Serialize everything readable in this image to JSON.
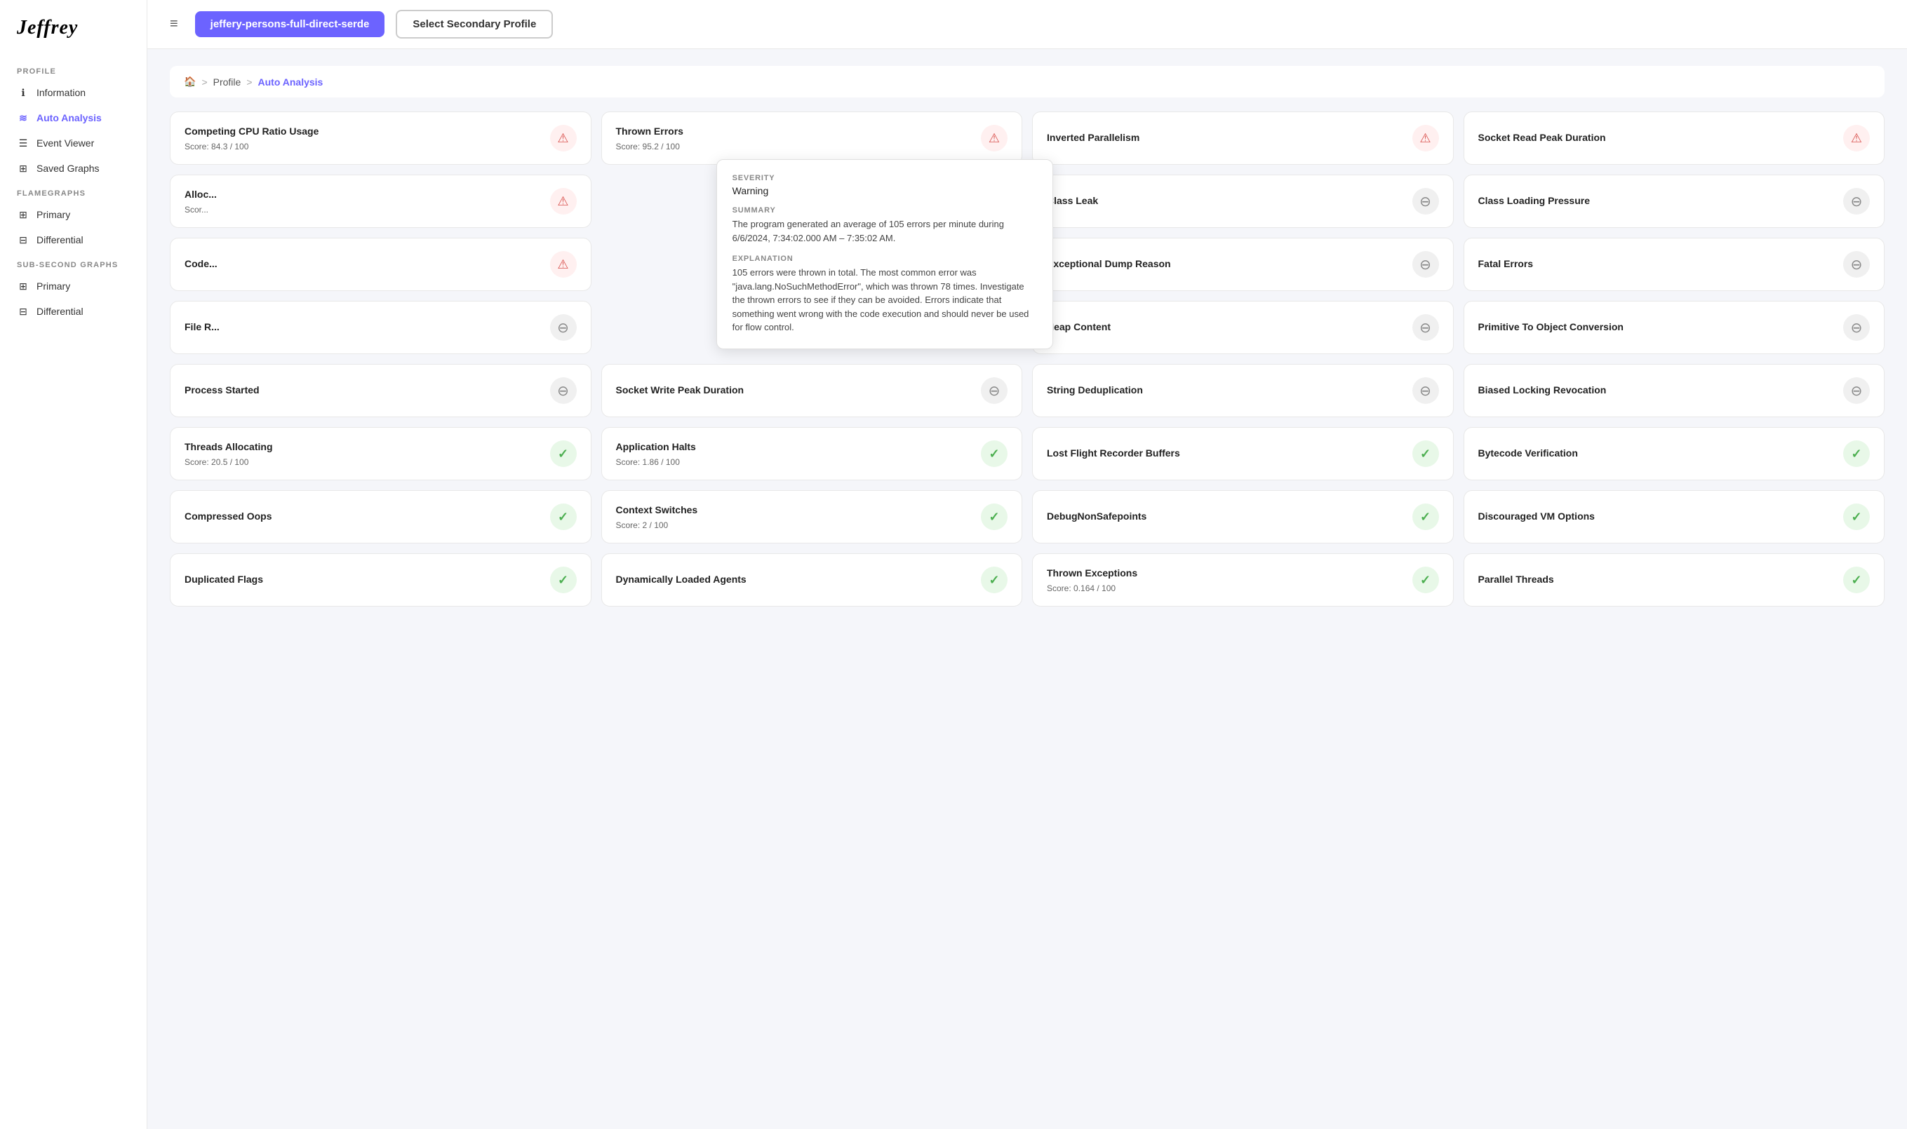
{
  "app": {
    "logo": "Jeffrey",
    "menu_icon": "≡"
  },
  "topbar": {
    "primary_profile_label": "jeffery-persons-full-direct-serde",
    "secondary_profile_label": "Select Secondary Profile"
  },
  "sidebar": {
    "sections": [
      {
        "label": "PROFILE",
        "items": [
          {
            "id": "information",
            "label": "Information",
            "icon": "ℹ",
            "active": false
          },
          {
            "id": "auto-analysis",
            "label": "Auto Analysis",
            "icon": "≋",
            "active": true
          },
          {
            "id": "event-viewer",
            "label": "Event Viewer",
            "icon": "☰",
            "active": false
          },
          {
            "id": "saved-graphs",
            "label": "Saved Graphs",
            "icon": "⊞",
            "active": false
          }
        ]
      },
      {
        "label": "FLAMEGRAPHS",
        "items": [
          {
            "id": "fg-primary",
            "label": "Primary",
            "icon": "⊞",
            "active": false
          },
          {
            "id": "fg-differential",
            "label": "Differential",
            "icon": "⊟",
            "active": false
          }
        ]
      },
      {
        "label": "SUB-SECOND GRAPHS",
        "items": [
          {
            "id": "ssg-primary",
            "label": "Primary",
            "icon": "⊞",
            "active": false
          },
          {
            "id": "ssg-differential",
            "label": "Differential",
            "icon": "⊟",
            "active": false
          }
        ]
      }
    ]
  },
  "breadcrumb": {
    "home": "🏠",
    "sep1": ">",
    "profile": "Profile",
    "sep2": ">",
    "current": "Auto Analysis"
  },
  "tooltip": {
    "severity_label": "Severity",
    "severity_value": "Warning",
    "summary_label": "Summary",
    "summary_text": "The program generated an average of 105 errors per minute during 6/6/2024, 7:34:02.000 AM – 7:35:02 AM.",
    "explanation_label": "Explanation",
    "explanation_text": "105 errors were thrown in total. The most common error was \"java.lang.NoSuchMethodError\", which was thrown 78 times. Investigate the thrown errors to see if they can be avoided. Errors indicate that something went wrong with the code execution and should never be used for flow control."
  },
  "cards": [
    {
      "id": "competing-cpu",
      "title": "Competing CPU Ratio Usage",
      "score": "Score: 84.3 / 100",
      "status": "warning",
      "row": 0,
      "col": 0
    },
    {
      "id": "thrown-errors",
      "title": "Thrown Errors",
      "score": "Score: 95.2 / 100",
      "status": "warning",
      "row": 0,
      "col": 1,
      "has_tooltip": true
    },
    {
      "id": "inverted-parallelism",
      "title": "Inverted Parallelism",
      "score": "",
      "status": "warning",
      "row": 0,
      "col": 2
    },
    {
      "id": "socket-read-peak",
      "title": "Socket Read Peak Duration",
      "score": "",
      "status": "warning",
      "row": 0,
      "col": 3
    },
    {
      "id": "allocation-pressure",
      "title": "Alloc...",
      "score": "Scor...",
      "status": "warning",
      "row": 1,
      "col": 0
    },
    {
      "id": "class-leak",
      "title": "Class Leak",
      "score": "",
      "status": "neutral",
      "row": 1,
      "col": 2
    },
    {
      "id": "class-loading-pressure",
      "title": "Class Loading Pressure",
      "score": "",
      "status": "neutral",
      "row": 1,
      "col": 3
    },
    {
      "id": "code-cache",
      "title": "Code...",
      "score": "",
      "status": "warning",
      "row": 2,
      "col": 0
    },
    {
      "id": "exceptional-dump",
      "title": "Exceptional Dump Reason",
      "score": "",
      "status": "neutral",
      "row": 2,
      "col": 2
    },
    {
      "id": "fatal-errors",
      "title": "Fatal Errors",
      "score": "",
      "status": "neutral",
      "row": 2,
      "col": 3
    },
    {
      "id": "file-read",
      "title": "File R...",
      "score": "",
      "status": "neutral",
      "row": 3,
      "col": 0
    },
    {
      "id": "heap-content",
      "title": "Heap Content",
      "score": "",
      "status": "neutral",
      "row": 3,
      "col": 2
    },
    {
      "id": "primitive-to-object",
      "title": "Primitive To Object Conversion",
      "score": "",
      "status": "neutral",
      "row": 3,
      "col": 3
    },
    {
      "id": "process-started",
      "title": "Process Started",
      "score": "",
      "status": "neutral",
      "row": 4,
      "col": 0
    },
    {
      "id": "socket-write-peak",
      "title": "Socket Write Peak Duration",
      "score": "",
      "status": "neutral",
      "row": 4,
      "col": 1
    },
    {
      "id": "string-deduplication",
      "title": "String Deduplication",
      "score": "",
      "status": "neutral",
      "row": 4,
      "col": 2
    },
    {
      "id": "biased-locking",
      "title": "Biased Locking Revocation",
      "score": "",
      "status": "neutral",
      "row": 4,
      "col": 3
    },
    {
      "id": "threads-allocating",
      "title": "Threads Allocating",
      "score": "Score: 20.5 / 100",
      "status": "ok",
      "row": 5,
      "col": 0
    },
    {
      "id": "application-halts",
      "title": "Application Halts",
      "score": "Score: 1.86 / 100",
      "status": "ok",
      "row": 5,
      "col": 1
    },
    {
      "id": "lost-flight-recorder",
      "title": "Lost Flight Recorder Buffers",
      "score": "",
      "status": "ok",
      "row": 5,
      "col": 2
    },
    {
      "id": "bytecode-verification",
      "title": "Bytecode Verification",
      "score": "",
      "status": "ok",
      "row": 5,
      "col": 3
    },
    {
      "id": "compressed-oops",
      "title": "Compressed Oops",
      "score": "",
      "status": "ok",
      "row": 6,
      "col": 0
    },
    {
      "id": "context-switches",
      "title": "Context Switches",
      "score": "Score: 2 / 100",
      "status": "ok",
      "row": 6,
      "col": 1
    },
    {
      "id": "debugnon-safepoints",
      "title": "DebugNonSafepoints",
      "score": "",
      "status": "ok",
      "row": 6,
      "col": 2
    },
    {
      "id": "discouraged-vm",
      "title": "Discouraged VM Options",
      "score": "",
      "status": "ok",
      "row": 6,
      "col": 3
    },
    {
      "id": "duplicated-flags",
      "title": "Duplicated Flags",
      "score": "",
      "status": "ok",
      "row": 7,
      "col": 0
    },
    {
      "id": "dynamically-loaded",
      "title": "Dynamically Loaded Agents",
      "score": "",
      "status": "ok",
      "row": 7,
      "col": 1
    },
    {
      "id": "thrown-exceptions",
      "title": "Thrown Exceptions",
      "score": "Score: 0.164 / 100",
      "status": "ok",
      "row": 7,
      "col": 2
    },
    {
      "id": "parallel-threads",
      "title": "Parallel Threads",
      "score": "",
      "status": "ok",
      "row": 7,
      "col": 3
    }
  ]
}
